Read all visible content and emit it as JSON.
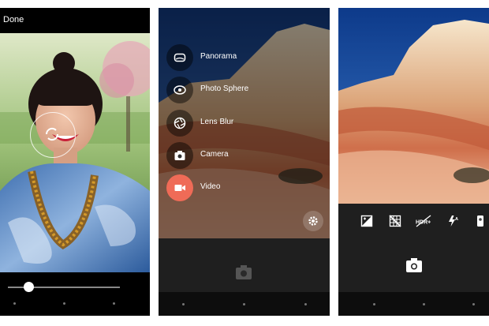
{
  "panel1": {
    "done_label": "Done",
    "blur_level": 0.19
  },
  "panel2": {
    "modes": [
      {
        "label": "Panorama",
        "icon": "panorama-icon"
      },
      {
        "label": "Photo Sphere",
        "icon": "photo-sphere-icon"
      },
      {
        "label": "Lens Blur",
        "icon": "lens-blur-icon"
      },
      {
        "label": "Camera",
        "icon": "camera-icon"
      },
      {
        "label": "Video",
        "icon": "video-icon"
      }
    ],
    "accent": "#ef6b57"
  },
  "panel3": {
    "settings_icons": [
      "exposure-icon",
      "grid-off-icon",
      "hdr-plus-icon",
      "flash-auto-icon",
      "switch-camera-icon"
    ]
  }
}
